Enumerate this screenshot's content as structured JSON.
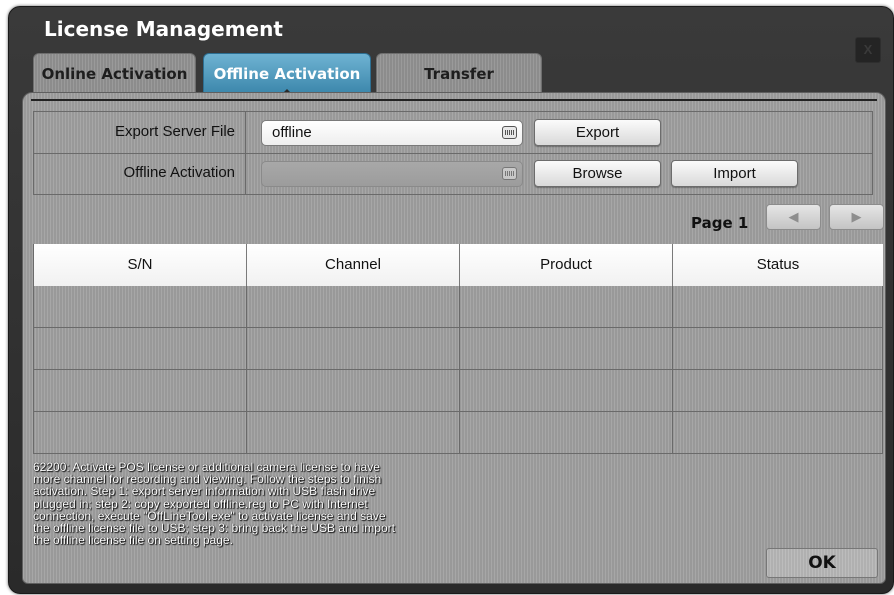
{
  "dialog": {
    "title": "License Management",
    "close_glyph": "X"
  },
  "tabs": [
    {
      "label": "Online Activation",
      "active": false
    },
    {
      "label": "Offline Activation",
      "active": true
    },
    {
      "label": "Transfer",
      "active": false
    }
  ],
  "form": {
    "export_label": "Export Server File",
    "export_value": "offline",
    "export_button": "Export",
    "offline_label": "Offline Activation",
    "offline_value": "",
    "browse_button": "Browse",
    "import_button": "Import",
    "keyboard_icon": "keyboard-icon"
  },
  "pager": {
    "label": "Page 1",
    "prev_glyph": "◀",
    "next_glyph": "▶"
  },
  "table": {
    "columns": [
      "S/N",
      "Channel",
      "Product",
      "Status"
    ],
    "rows": [
      [
        "",
        "",
        "",
        ""
      ],
      [
        "",
        "",
        "",
        ""
      ],
      [
        "",
        "",
        "",
        ""
      ],
      [
        "",
        "",
        "",
        ""
      ]
    ]
  },
  "note": {
    "lines": [
      "62200: Activate POS license or additional camera license to have",
      "more channel for recording and viewing. Follow the steps to finish",
      "activation. Step 1: export server information with USB flash drive",
      "plugged in; step 2: copy exported offline.reg to PC with Internet",
      "connection, execute \"OffLineTool.exe\" to activate license and save",
      "the offline license file to USB; step 3: bring back the USB and import",
      "the offline license file on setting page."
    ]
  },
  "footer": {
    "ok_label": "OK"
  },
  "colors": {
    "frame": "#2f2f2f",
    "active_tab": "#4a95bb",
    "panel": "#a0a0a0"
  }
}
